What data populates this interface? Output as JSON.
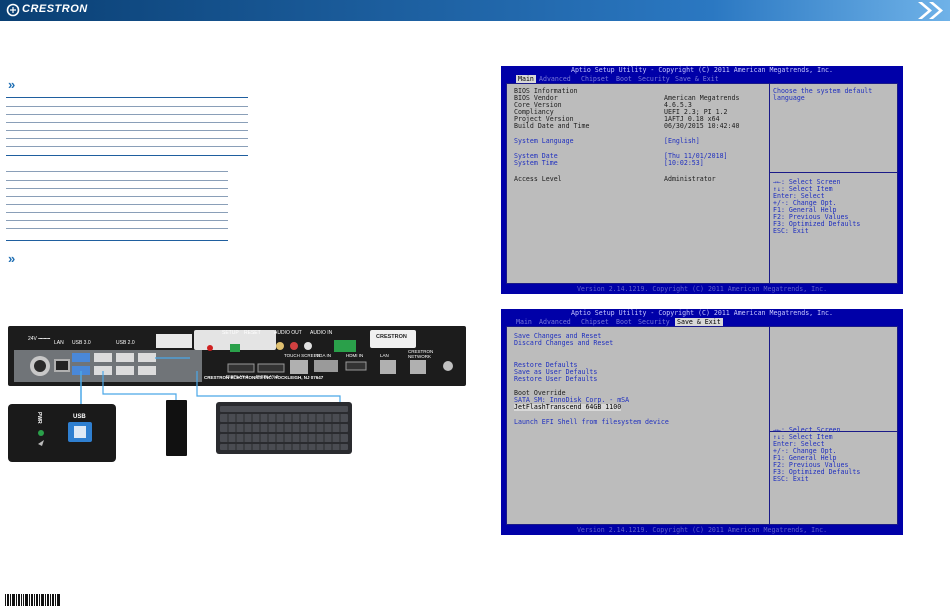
{
  "header": {
    "brand": "CRESTRON",
    "colors": {
      "bar_start": "#0a3f73",
      "bar_end": "#5aa0d8",
      "accent": "#1f6fb4"
    }
  },
  "bios_main": {
    "title": "Aptio Setup Utility - Copyright (C) 2011 American Megatrends, Inc.",
    "tabs": [
      "Main",
      "Advanced",
      "Chipset",
      "Boot",
      "Security",
      "Save & Exit"
    ],
    "rows": [
      {
        "label": "BIOS Information",
        "value": ""
      },
      {
        "label": "BIOS Vendor",
        "value": "American Megatrends"
      },
      {
        "label": "Core Version",
        "value": "4.6.5.3"
      },
      {
        "label": "Compliancy",
        "value": "UEFI 2.3; PI 1.2"
      },
      {
        "label": "Project Version",
        "value": "1AFTJ 0.18 x64"
      },
      {
        "label": "Build Date and Time",
        "value": "06/30/2015 10:42:40"
      }
    ],
    "language_label": "System Language",
    "language_value": "[English]",
    "date_label": "System Date",
    "date_value": "[Thu 11/01/2018]",
    "time_label": "System Time",
    "time_value": "[10:02:53]",
    "access_label": "Access Level",
    "access_value": "Administrator",
    "help": [
      "Choose the system default",
      "language"
    ],
    "keys": [
      "→←: Select Screen",
      "↑↓: Select Item",
      "Enter: Select",
      "+/-: Change Opt.",
      "F1: General Help",
      "F2: Previous Values",
      "F3: Optimized Defaults",
      "ESC: Exit"
    ],
    "footer": "Version 2.14.1219. Copyright (C) 2011 American Megatrends, Inc."
  },
  "bios_exit": {
    "title": "Aptio Setup Utility - Copyright (C) 2011 American Megatrends, Inc.",
    "tabs": [
      "Main",
      "Advanced",
      "Chipset",
      "Boot",
      "Security",
      "Save & Exit"
    ],
    "items": [
      "Save Changes and Reset",
      "Discard Changes and Reset",
      "Restore Defaults",
      "Save as User Defaults",
      "Restore User Defaults",
      "Boot Override",
      "SATA  SM: InnoDisk Corp. - mSA",
      "JetFlashTranscend 64GB 1100",
      "Launch EFI Shell from filesystem device"
    ],
    "keys": [
      "→←: Select Screen",
      "↑↓: Select Item",
      "Enter: Select",
      "+/-: Change Opt.",
      "F1: General Help",
      "F2: Previous Values",
      "F3: Optimized Defaults",
      "ESC: Exit"
    ],
    "footer": "Version 2.14.1219. Copyright (C) 2011 American Megatrends, Inc."
  },
  "device": {
    "usb_label": "USB",
    "pwr_label": "PWR",
    "back_panel": {
      "power": "24V ⎓⎓⎓",
      "lan": "LAN",
      "usb2": "USB 2.0",
      "usb3": "USB 3.0",
      "setup": "SETUP",
      "reset": "RESET",
      "audio_out": "AUDIO OUT",
      "audio_in": "AUDIO IN",
      "display1": "DISPLAY 1",
      "display2": "DISPLAY 2",
      "touch_screen": "TOUCH SCREEN",
      "vga": "VGA IN",
      "hdmi": "HDMI IN",
      "lan2": "LAN",
      "network": "CRESTRON NETWORK",
      "logo": "CRESTRON",
      "company": "CRESTRON ELECTRONICS INC. ROCKLEIGH, NJ 07647"
    }
  }
}
